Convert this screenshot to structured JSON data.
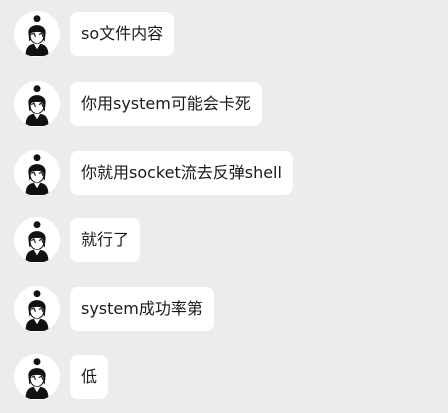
{
  "chat": {
    "messages": [
      {
        "text": "so文件内容"
      },
      {
        "text": "你用system可能会卡死"
      },
      {
        "text": "你就用socket流去反弹shell"
      },
      {
        "text": "就行了"
      },
      {
        "text": "system成功率第"
      },
      {
        "text": "低"
      }
    ]
  },
  "avatar": {
    "icon": "bun-hair-character-avatar"
  },
  "colors": {
    "background": "#ececec",
    "bubble": "#ffffff",
    "text": "#1a1a1a"
  }
}
